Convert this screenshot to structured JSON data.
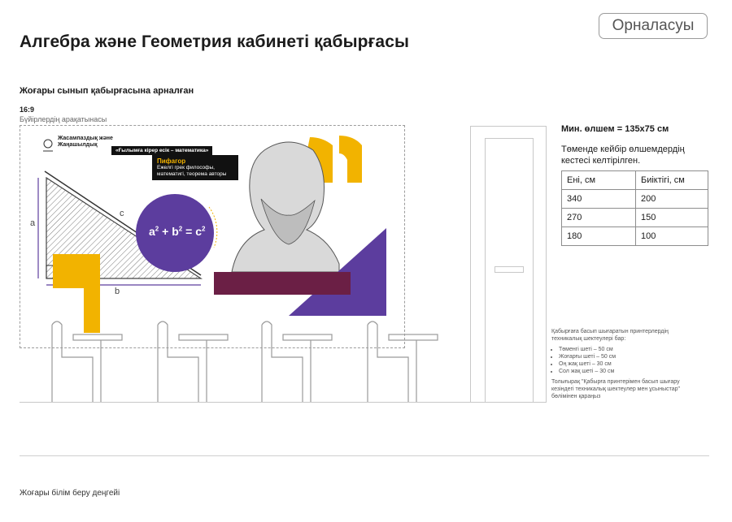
{
  "header": {
    "title": "Алгебра және Геометрия кабинеті қабырғасы",
    "placement_button": "Орналасуы",
    "subtitle": "Жоғары сынып қабырғасына арналған",
    "ratio": "16:9",
    "ratio_caption": "Бүйірлердің арақатынасы"
  },
  "artwork": {
    "brand_line1": "Жасампаздық және",
    "brand_line2": "Жаңашылдық",
    "motto": "«Ғылымға кірер есік – математика»",
    "pythagoras_name": "Пифагор",
    "pythagoras_desc_line1": "Ежелгі грек философы,",
    "pythagoras_desc_line2": "математигі, теорема авторы",
    "formula_a": "a",
    "formula_b": "b",
    "formula_c": "c",
    "sup": "2",
    "label_a": "a",
    "label_b": "b",
    "label_c": "c",
    "colors": {
      "yellow": "#f2b300",
      "purple": "#5c3d9e",
      "maroon": "#6b1f45",
      "black": "#111111"
    }
  },
  "sidebar": {
    "min_size": "Мин. өлшем = 135x75 см",
    "table_intro": "Төменде кейбір өлшемдердің кестесі келтірілген.",
    "table": {
      "headers": [
        "Ені, см",
        "Биіктігі, см"
      ],
      "rows": [
        [
          "340",
          "200"
        ],
        [
          "270",
          "150"
        ],
        [
          "180",
          "100"
        ]
      ]
    },
    "notes_intro": "Қабырғаға басып шығаратын принтерлердің техникалық шектеулері бар:",
    "notes_items": [
      "Төменгі шеті – 50 см",
      "Жоғарғы шеті – 50 см",
      "Оң жақ шеті – 30 см",
      "Сол жақ шеті – 30 см"
    ],
    "notes_outro": "Толығырақ \"Қабырға принтерімен басып шығару кезіндегі техникалық шектеулер мен ұсыныстар\" бөлімінен қараңыз"
  },
  "footer": {
    "label": "Жоғары білім беру деңгейі"
  }
}
